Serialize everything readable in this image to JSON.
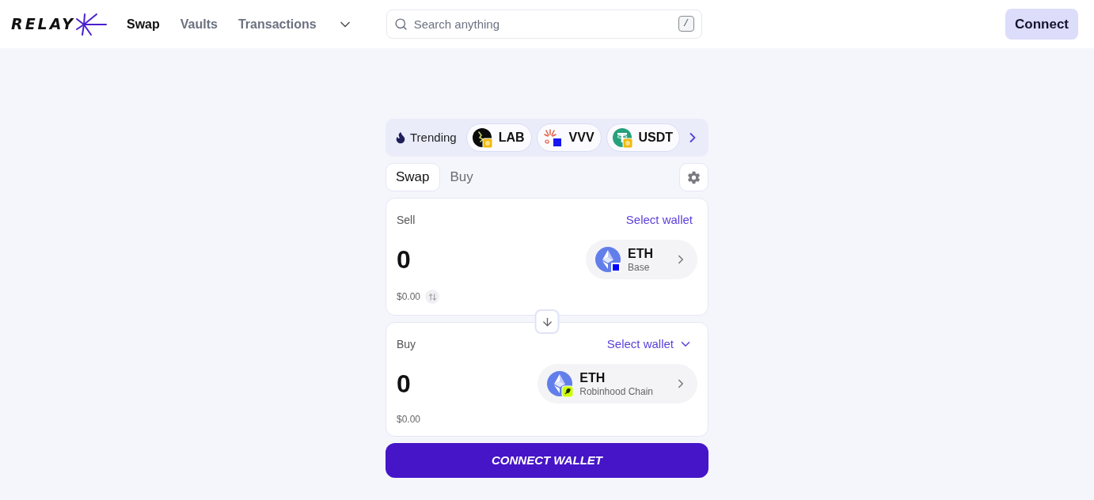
{
  "header": {
    "logo": "RELAY",
    "nav": [
      {
        "label": "Swap",
        "selected": true
      },
      {
        "label": "Vaults",
        "selected": false
      },
      {
        "label": "Transactions",
        "selected": false
      }
    ],
    "search": {
      "placeholder": "Search anything",
      "shortcut": "/"
    },
    "connect_button": "Connect"
  },
  "trending": {
    "label": "Trending",
    "tokens": [
      {
        "symbol": "LAB"
      },
      {
        "symbol": "VVV"
      },
      {
        "symbol": "USDT"
      }
    ]
  },
  "tabs": [
    {
      "label": "Swap",
      "selected": true
    },
    {
      "label": "Buy",
      "selected": false
    }
  ],
  "panels": [
    {
      "kind": "sell",
      "label": "Sell",
      "wallet_link": "Select wallet",
      "amount": "0",
      "token": "ETH",
      "chain": "Base",
      "usd_value": "$0.00"
    },
    {
      "kind": "buy",
      "label": "Buy",
      "wallet_link": "Select wallet",
      "amount": "0",
      "token": "ETH",
      "chain": "Robinhood Chain",
      "usd_value": "$0.00"
    }
  ],
  "primary_button": "CONNECT WALLET"
}
